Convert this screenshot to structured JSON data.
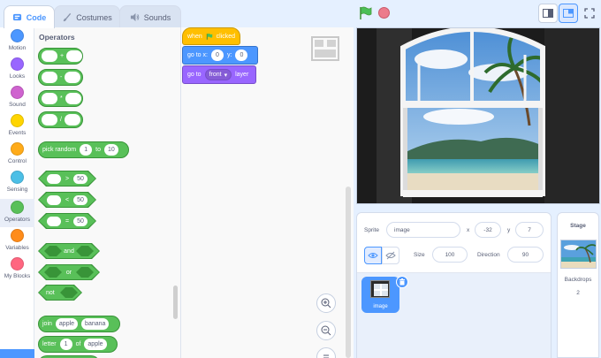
{
  "tabs": [
    {
      "label": "Code",
      "icon": "code-icon",
      "active": true
    },
    {
      "label": "Costumes",
      "icon": "brush-icon",
      "active": false
    },
    {
      "label": "Sounds",
      "icon": "speaker-icon",
      "active": false
    }
  ],
  "categories": [
    {
      "label": "Motion",
      "color": "#4c97ff"
    },
    {
      "label": "Looks",
      "color": "#9966ff"
    },
    {
      "label": "Sound",
      "color": "#cf63cf"
    },
    {
      "label": "Events",
      "color": "#ffd500"
    },
    {
      "label": "Control",
      "color": "#ffab19"
    },
    {
      "label": "Sensing",
      "color": "#4cbfe6"
    },
    {
      "label": "Operators",
      "color": "#59c059"
    },
    {
      "label": "Variables",
      "color": "#ff8c1a"
    },
    {
      "label": "My Blocks",
      "color": "#ff6680"
    }
  ],
  "palette": {
    "title": "Operators",
    "arith_ops": [
      "+",
      "-",
      "*",
      "/"
    ],
    "pick_random": {
      "label": "pick random",
      "from": "1",
      "to_label": "to",
      "to": "10"
    },
    "compare": [
      {
        "op": ">",
        "value": "50"
      },
      {
        "op": "<",
        "value": "50"
      },
      {
        "op": "=",
        "value": "50"
      }
    ],
    "logic": {
      "and": "and",
      "or": "or",
      "not": "not"
    },
    "join": {
      "label": "join",
      "a": "apple",
      "b": "banana"
    },
    "letter": {
      "label": "letter",
      "index": "1",
      "of_label": "of",
      "word": "apple"
    }
  },
  "script": {
    "when_clicked": {
      "when": "when",
      "clicked": "clicked"
    },
    "goto_xy": {
      "label": "go to x:",
      "x": "0",
      "y_label": "y:",
      "y": "0"
    },
    "goto_layer": {
      "label": "go to",
      "option": "front",
      "suffix": "layer"
    },
    "colors": {
      "events": "#ffbf00",
      "motion": "#4c97ff",
      "looks": "#9966ff"
    }
  },
  "sprite_info": {
    "sprite_label": "Sprite",
    "sprite_name": "image",
    "x_label": "x",
    "x": "-32",
    "y_label": "y",
    "y": "7",
    "size_label": "Size",
    "size": "100",
    "direction_label": "Direction",
    "direction": "90"
  },
  "sprites": [
    {
      "name": "image",
      "selected": true
    }
  ],
  "stage_panel": {
    "title": "Stage",
    "backdrops_label": "Backdrops",
    "backdrops_count": "2"
  }
}
